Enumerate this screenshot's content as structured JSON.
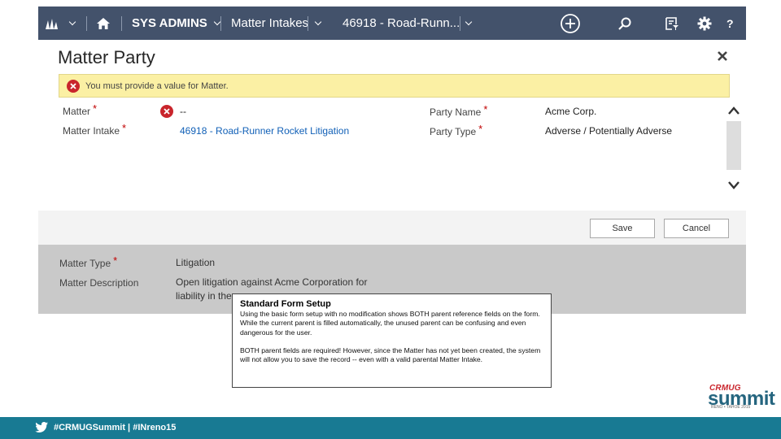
{
  "topbar": {
    "module": "SYS ADMINS",
    "entity": "Matter Intakes",
    "record": "46918 - Road-Runn...",
    "help": "?"
  },
  "background_form": {
    "fields": [
      {
        "label": "Matter Type",
        "value": "Litigation"
      },
      {
        "label": "Matter Description",
        "line1": "Open litigation against Acme Corporation for",
        "line2": "liability in the"
      }
    ]
  },
  "dialog": {
    "title": "Matter Party",
    "error_message": "You must provide a value for Matter.",
    "fields": {
      "matter": {
        "label": "Matter",
        "value": "--"
      },
      "matter_intake": {
        "label": "Matter Intake",
        "value": "46918 - Road-Runner Rocket Litigation"
      },
      "party_name": {
        "label": "Party Name",
        "value": "Acme Corp."
      },
      "party_type": {
        "label": "Party Type",
        "value": "Adverse / Potentially Adverse"
      }
    },
    "required_mark": "*",
    "save_label": "Save",
    "cancel_label": "Cancel"
  },
  "callout": {
    "title": "Standard Form Setup",
    "paragraph1": "Using the basic form setup with no modification shows BOTH parent reference fields on the form.  While the current parent is filled automatically, the unused parent can be confusing and even dangerous for the user.",
    "paragraph2": "BOTH parent fields are required! However, since the Matter has not yet been created, the system will not allow you to save the record -- even with a valid parental Matter Intake."
  },
  "branding": {
    "logo_top": "CRMUG",
    "logo_main": "summit",
    "logo_sub": "RENO • TAHOE 2015"
  },
  "footer": {
    "hashtags": "#CRMUGSummit | #INreno15"
  },
  "colors": {
    "nav": "#43526b",
    "error_banner": "#fbf0a4",
    "error_icon": "#c9252c",
    "link": "#1160b7",
    "bottom_bar": "#187a93"
  }
}
